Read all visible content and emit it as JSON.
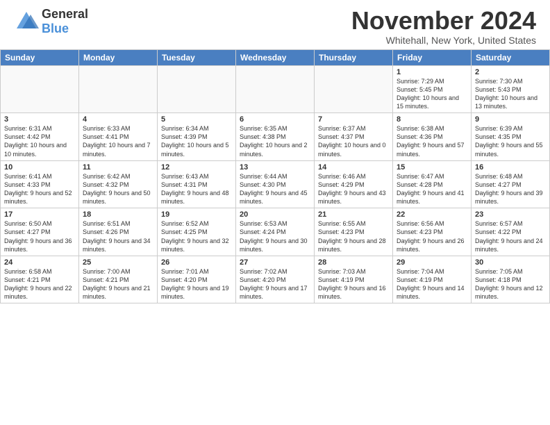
{
  "logo": {
    "general": "General",
    "blue": "Blue"
  },
  "header": {
    "month": "November 2024",
    "location": "Whitehall, New York, United States"
  },
  "weekdays": [
    "Sunday",
    "Monday",
    "Tuesday",
    "Wednesday",
    "Thursday",
    "Friday",
    "Saturday"
  ],
  "weeks": [
    [
      {
        "day": "",
        "info": ""
      },
      {
        "day": "",
        "info": ""
      },
      {
        "day": "",
        "info": ""
      },
      {
        "day": "",
        "info": ""
      },
      {
        "day": "",
        "info": ""
      },
      {
        "day": "1",
        "info": "Sunrise: 7:29 AM\nSunset: 5:45 PM\nDaylight: 10 hours and 15 minutes."
      },
      {
        "day": "2",
        "info": "Sunrise: 7:30 AM\nSunset: 5:43 PM\nDaylight: 10 hours and 13 minutes."
      }
    ],
    [
      {
        "day": "3",
        "info": "Sunrise: 6:31 AM\nSunset: 4:42 PM\nDaylight: 10 hours and 10 minutes."
      },
      {
        "day": "4",
        "info": "Sunrise: 6:33 AM\nSunset: 4:41 PM\nDaylight: 10 hours and 7 minutes."
      },
      {
        "day": "5",
        "info": "Sunrise: 6:34 AM\nSunset: 4:39 PM\nDaylight: 10 hours and 5 minutes."
      },
      {
        "day": "6",
        "info": "Sunrise: 6:35 AM\nSunset: 4:38 PM\nDaylight: 10 hours and 2 minutes."
      },
      {
        "day": "7",
        "info": "Sunrise: 6:37 AM\nSunset: 4:37 PM\nDaylight: 10 hours and 0 minutes."
      },
      {
        "day": "8",
        "info": "Sunrise: 6:38 AM\nSunset: 4:36 PM\nDaylight: 9 hours and 57 minutes."
      },
      {
        "day": "9",
        "info": "Sunrise: 6:39 AM\nSunset: 4:35 PM\nDaylight: 9 hours and 55 minutes."
      }
    ],
    [
      {
        "day": "10",
        "info": "Sunrise: 6:41 AM\nSunset: 4:33 PM\nDaylight: 9 hours and 52 minutes."
      },
      {
        "day": "11",
        "info": "Sunrise: 6:42 AM\nSunset: 4:32 PM\nDaylight: 9 hours and 50 minutes."
      },
      {
        "day": "12",
        "info": "Sunrise: 6:43 AM\nSunset: 4:31 PM\nDaylight: 9 hours and 48 minutes."
      },
      {
        "day": "13",
        "info": "Sunrise: 6:44 AM\nSunset: 4:30 PM\nDaylight: 9 hours and 45 minutes."
      },
      {
        "day": "14",
        "info": "Sunrise: 6:46 AM\nSunset: 4:29 PM\nDaylight: 9 hours and 43 minutes."
      },
      {
        "day": "15",
        "info": "Sunrise: 6:47 AM\nSunset: 4:28 PM\nDaylight: 9 hours and 41 minutes."
      },
      {
        "day": "16",
        "info": "Sunrise: 6:48 AM\nSunset: 4:27 PM\nDaylight: 9 hours and 39 minutes."
      }
    ],
    [
      {
        "day": "17",
        "info": "Sunrise: 6:50 AM\nSunset: 4:27 PM\nDaylight: 9 hours and 36 minutes."
      },
      {
        "day": "18",
        "info": "Sunrise: 6:51 AM\nSunset: 4:26 PM\nDaylight: 9 hours and 34 minutes."
      },
      {
        "day": "19",
        "info": "Sunrise: 6:52 AM\nSunset: 4:25 PM\nDaylight: 9 hours and 32 minutes."
      },
      {
        "day": "20",
        "info": "Sunrise: 6:53 AM\nSunset: 4:24 PM\nDaylight: 9 hours and 30 minutes."
      },
      {
        "day": "21",
        "info": "Sunrise: 6:55 AM\nSunset: 4:23 PM\nDaylight: 9 hours and 28 minutes."
      },
      {
        "day": "22",
        "info": "Sunrise: 6:56 AM\nSunset: 4:23 PM\nDaylight: 9 hours and 26 minutes."
      },
      {
        "day": "23",
        "info": "Sunrise: 6:57 AM\nSunset: 4:22 PM\nDaylight: 9 hours and 24 minutes."
      }
    ],
    [
      {
        "day": "24",
        "info": "Sunrise: 6:58 AM\nSunset: 4:21 PM\nDaylight: 9 hours and 22 minutes."
      },
      {
        "day": "25",
        "info": "Sunrise: 7:00 AM\nSunset: 4:21 PM\nDaylight: 9 hours and 21 minutes."
      },
      {
        "day": "26",
        "info": "Sunrise: 7:01 AM\nSunset: 4:20 PM\nDaylight: 9 hours and 19 minutes."
      },
      {
        "day": "27",
        "info": "Sunrise: 7:02 AM\nSunset: 4:20 PM\nDaylight: 9 hours and 17 minutes."
      },
      {
        "day": "28",
        "info": "Sunrise: 7:03 AM\nSunset: 4:19 PM\nDaylight: 9 hours and 16 minutes."
      },
      {
        "day": "29",
        "info": "Sunrise: 7:04 AM\nSunset: 4:19 PM\nDaylight: 9 hours and 14 minutes."
      },
      {
        "day": "30",
        "info": "Sunrise: 7:05 AM\nSunset: 4:18 PM\nDaylight: 9 hours and 12 minutes."
      }
    ]
  ]
}
